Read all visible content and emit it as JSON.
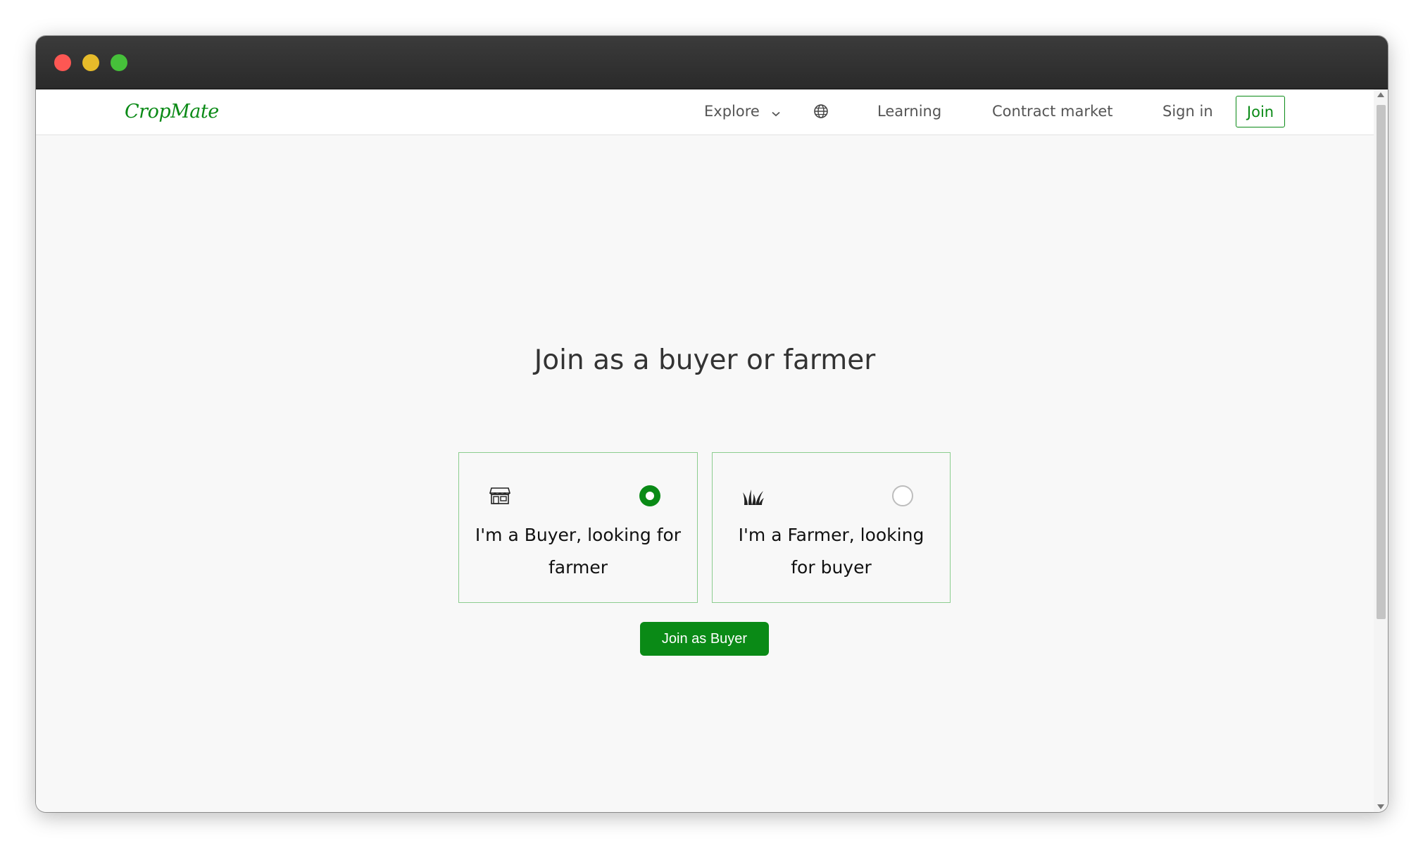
{
  "window": {
    "controls": [
      "close",
      "minimize",
      "maximize"
    ]
  },
  "nav": {
    "logo": "CropMate",
    "explore": "Explore",
    "learning": "Learning",
    "contract_market": "Contract market",
    "sign_in": "Sign in",
    "join": "Join",
    "globe_icon": "globe-icon",
    "explore_icon": "chevron-down-icon"
  },
  "main": {
    "heading": "Join as a buyer or farmer",
    "options": [
      {
        "label": "I'm a Buyer, looking for farmer",
        "icon": "store-icon",
        "selected": true
      },
      {
        "label": "I'm a Farmer, looking for buyer",
        "icon": "grass-icon",
        "selected": false
      }
    ],
    "cta": "Join as Buyer"
  },
  "colors": {
    "brand_green": "#0a8a16",
    "card_border": "#8ccd8f",
    "background": "#f8f8f8"
  }
}
